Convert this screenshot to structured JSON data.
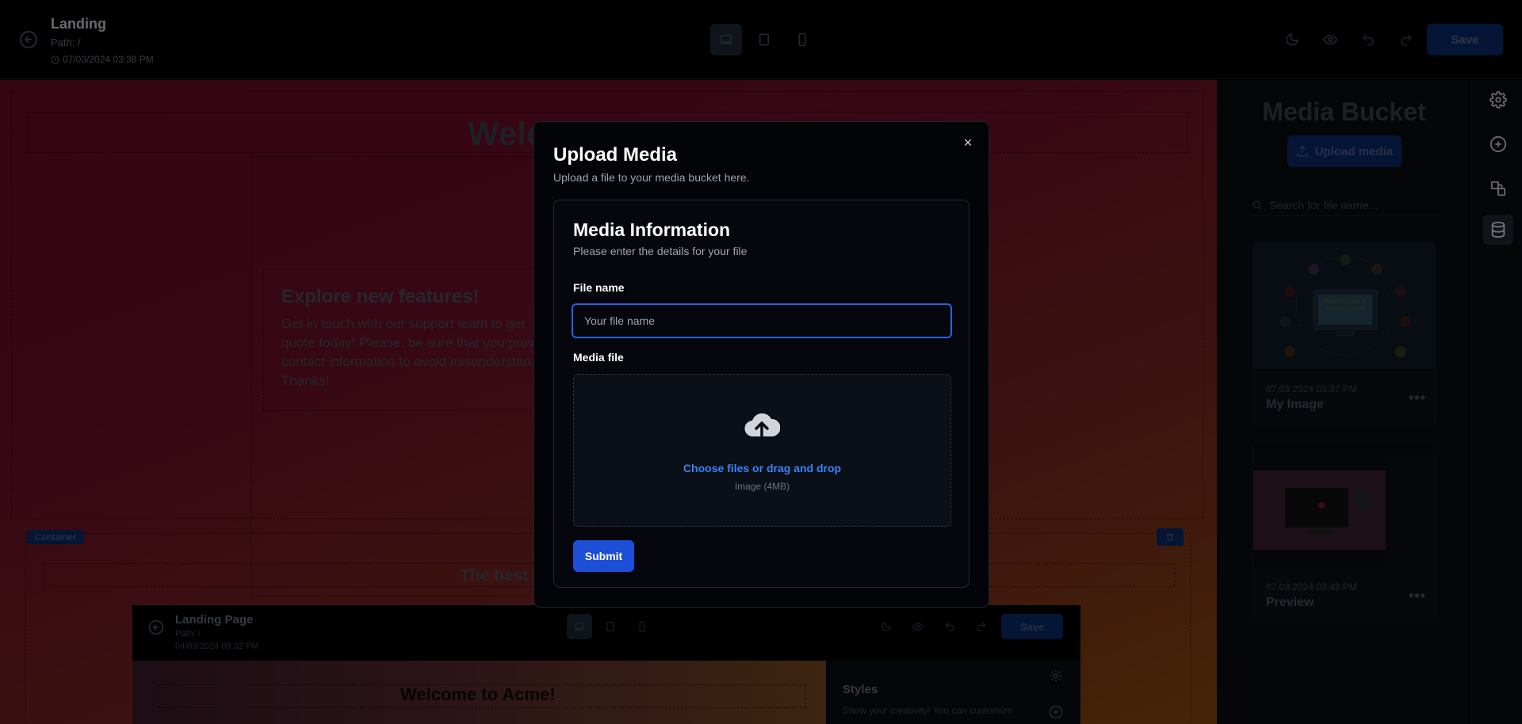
{
  "header": {
    "title": "Landing",
    "path": "Path: /",
    "date": "07/03/2024 03:38 PM",
    "save_label": "Save"
  },
  "canvas": {
    "heading": "Welco",
    "feature_title": "Explore new features!",
    "feature_text": "Get in touch with our support team to get quote today! Please, be sure that you prov contact information to avoid misunderstan Thanks!",
    "container_badge": "Container",
    "best_text": "The best w"
  },
  "nested_preview": {
    "title": "Landing Page",
    "path": "Path: /",
    "date": "04/03/2024 09:32 PM",
    "save_label": "Save",
    "heading": "Welcome to Acme!",
    "styles_title": "Styles",
    "styles_sub": "Show your creativity! You can customize"
  },
  "media_panel": {
    "title": "Media Bucket",
    "upload_label": "Upload media",
    "search_placeholder": "Search for file name...",
    "cards": [
      {
        "date": "07.03.2024 03:37 PM",
        "name": "My Image",
        "image_text": "Web Design & Development"
      },
      {
        "date": "07.03.2024 03:48 PM",
        "name": "Preview"
      }
    ]
  },
  "modal": {
    "title": "Upload Media",
    "subtitle": "Upload a file to your media bucket here.",
    "card_title": "Media Information",
    "card_subtitle": "Please enter the details for your file",
    "file_name_label": "File name",
    "file_name_placeholder": "Your file name",
    "media_file_label": "Media file",
    "dropzone_link": "Choose files or drag and drop",
    "dropzone_hint": "Image (4MB)",
    "submit_label": "Submit",
    "close_icon": "×"
  },
  "colors": {
    "accent": "#1d4ed8",
    "focus_ring": "#2563eb",
    "link": "#3b82f6"
  }
}
